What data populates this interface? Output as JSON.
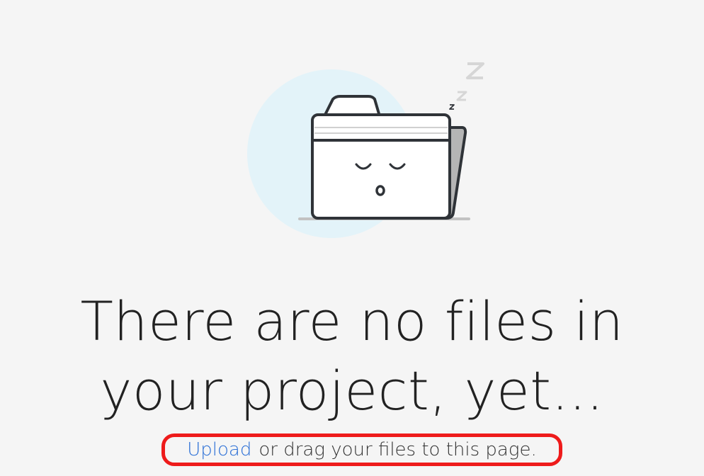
{
  "empty_state": {
    "headline_line1": "There are no files in",
    "headline_line2": "your project, yet...",
    "upload_link": "Upload",
    "upload_rest": "or drag your files to this page."
  },
  "colors": {
    "background": "#f5f5f5",
    "circle": "#e3f3f9",
    "link": "#2b6fd6",
    "highlight": "#ee1b1b"
  },
  "icons": {
    "illustration": "sleeping-folder-icon"
  }
}
